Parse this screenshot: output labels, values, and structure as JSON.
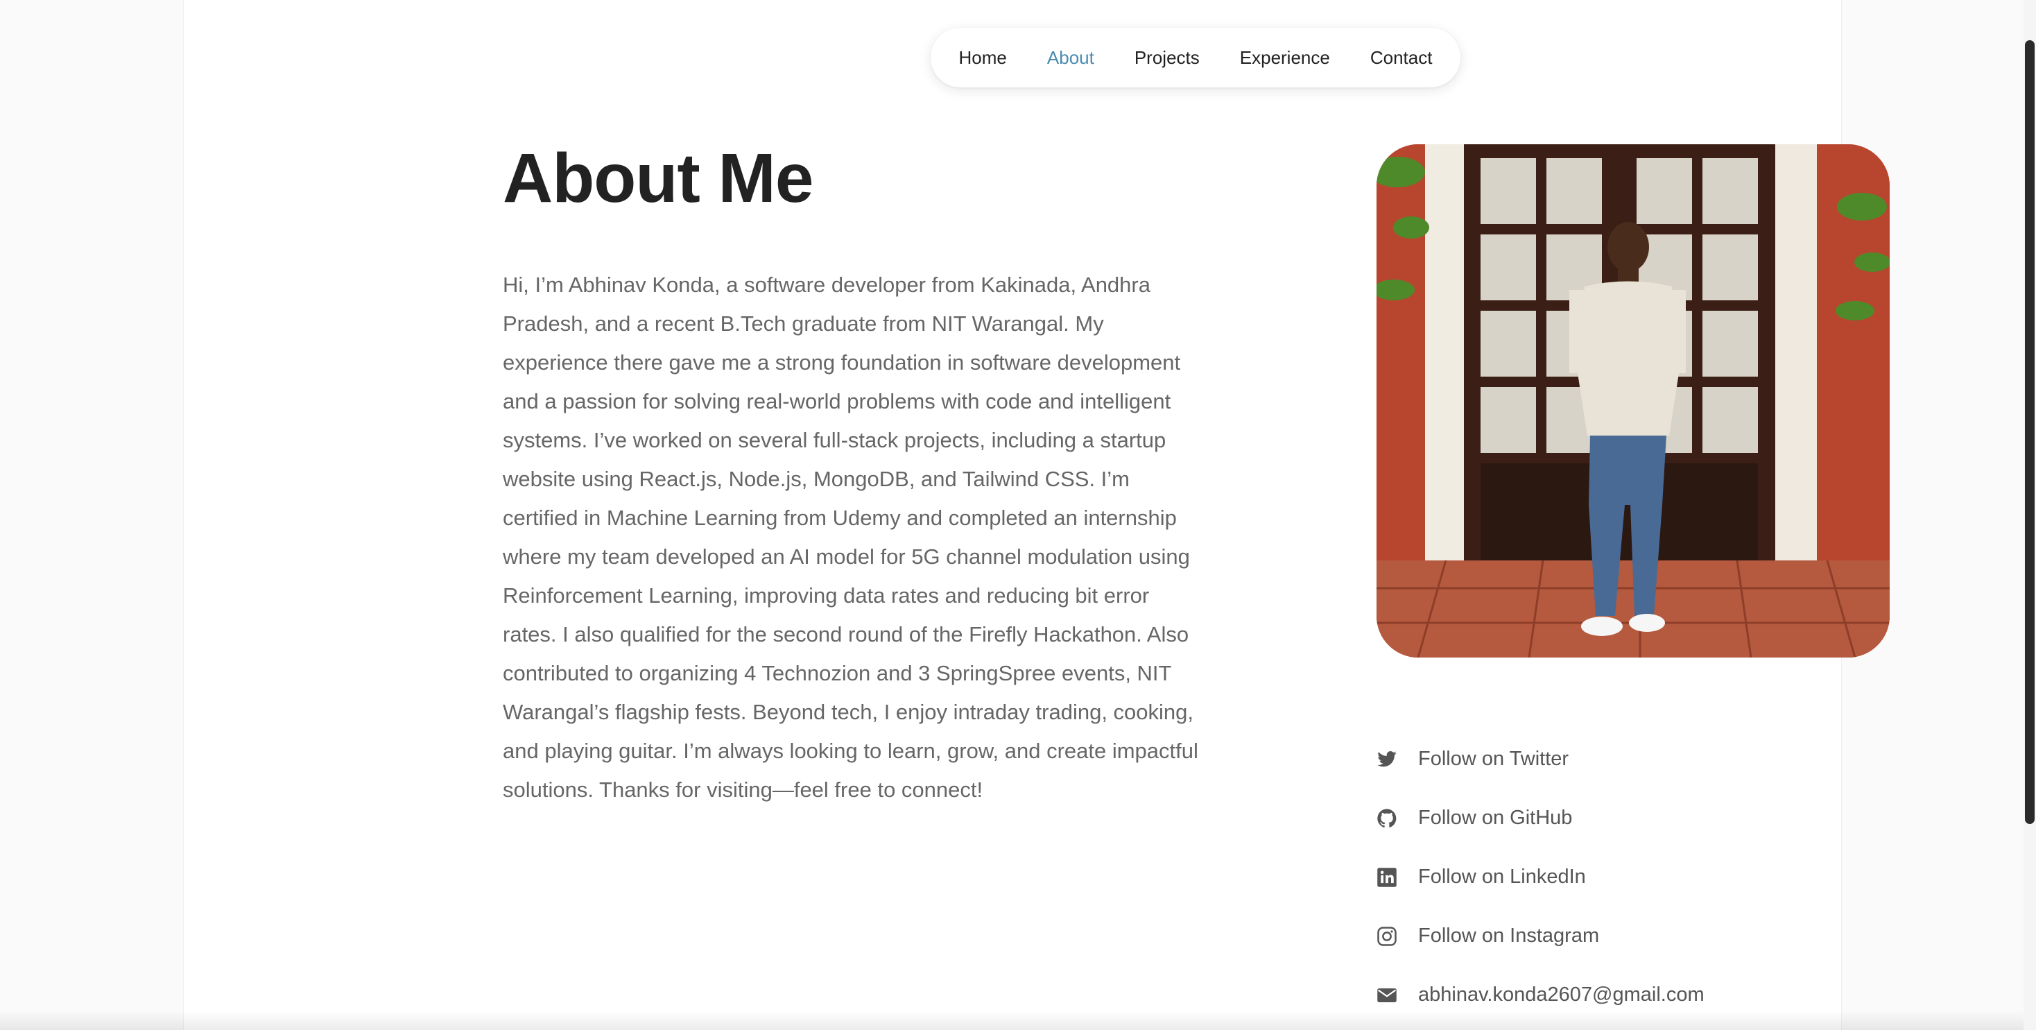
{
  "nav": {
    "items": [
      "Home",
      "About",
      "Projects",
      "Experience",
      "Contact"
    ],
    "active": "About",
    "active_color": "#4b8bb0"
  },
  "about": {
    "title": "About Me",
    "bio": "Hi, I’m Abhinav Konda, a software developer from Kakinada, Andhra Pradesh, and a recent B.Tech graduate from NIT Warangal. My experience there gave me a strong foundation in software development and a passion for solving real-world problems with code and intelligent systems. I’ve worked on several full-stack projects, including a startup website using React.js, Node.js, MongoDB, and Tailwind CSS. I’m certified in Machine Learning from Udemy and completed an internship where my team developed an AI model for 5G channel modulation using Reinforcement Learning, improving data rates and reducing bit error rates. I also qualified for the second round of the Firefly Hackathon. Also contributed to organizing 4 Technozion and 3 SpringSpree events, NIT Warangal’s flagship fests. Beyond tech, I enjoy intraday trading, cooking, and playing guitar. I’m always looking to learn, grow, and create impactful solutions. Thanks for visiting—feel free to connect!"
  },
  "social": [
    {
      "icon": "twitter-icon",
      "label": "Follow on Twitter"
    },
    {
      "icon": "github-icon",
      "label": "Follow on GitHub"
    },
    {
      "icon": "linkedin-icon",
      "label": "Follow on LinkedIn"
    },
    {
      "icon": "instagram-icon",
      "label": "Follow on Instagram"
    },
    {
      "icon": "mail-icon",
      "label": "abhinav.konda2607@gmail.com"
    }
  ]
}
